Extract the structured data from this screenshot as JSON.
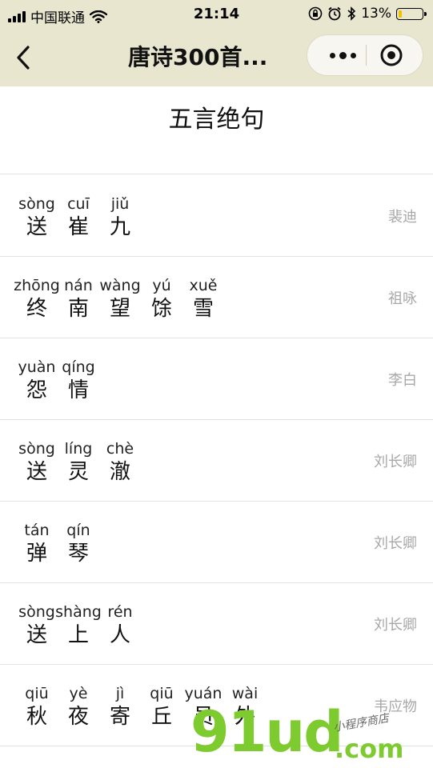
{
  "status_bar": {
    "carrier": "中国联通",
    "time": "21:14",
    "battery_percent": "13%"
  },
  "nav": {
    "title": "唐诗300首..."
  },
  "section_title": "五言绝句",
  "poems": [
    {
      "chars": [
        {
          "py": "sòng",
          "hz": "送"
        },
        {
          "py": "cuī",
          "hz": "崔"
        },
        {
          "py": "jiǔ",
          "hz": "九"
        }
      ],
      "author": "裴迪"
    },
    {
      "chars": [
        {
          "py": "zhōng",
          "hz": "终"
        },
        {
          "py": "nán",
          "hz": "南"
        },
        {
          "py": "wàng",
          "hz": "望"
        },
        {
          "py": "yú",
          "hz": "馀"
        },
        {
          "py": "xuě",
          "hz": "雪"
        }
      ],
      "author": "祖咏"
    },
    {
      "chars": [
        {
          "py": "yuàn",
          "hz": "怨"
        },
        {
          "py": "qíng",
          "hz": "情"
        }
      ],
      "author": "李白"
    },
    {
      "chars": [
        {
          "py": "sòng",
          "hz": "送"
        },
        {
          "py": "líng",
          "hz": "灵"
        },
        {
          "py": "chè",
          "hz": "澈"
        }
      ],
      "author": "刘长卿"
    },
    {
      "chars": [
        {
          "py": "tán",
          "hz": "弹"
        },
        {
          "py": "qín",
          "hz": "琴"
        }
      ],
      "author": "刘长卿"
    },
    {
      "chars": [
        {
          "py": "sòng",
          "hz": "送"
        },
        {
          "py": "shàng",
          "hz": "上"
        },
        {
          "py": "rén",
          "hz": "人"
        }
      ],
      "author": "刘长卿"
    },
    {
      "chars": [
        {
          "py": "qiū",
          "hz": "秋"
        },
        {
          "py": "yè",
          "hz": "夜"
        },
        {
          "py": "jì",
          "hz": "寄"
        },
        {
          "py": "qiū",
          "hz": "丘"
        },
        {
          "py": "yuán",
          "hz": "员"
        },
        {
          "py": "wài",
          "hz": "外"
        }
      ],
      "author": "韦应物"
    }
  ],
  "watermark": {
    "brand": "91ud",
    "domain": ".com",
    "tagline": "小程序商店"
  }
}
